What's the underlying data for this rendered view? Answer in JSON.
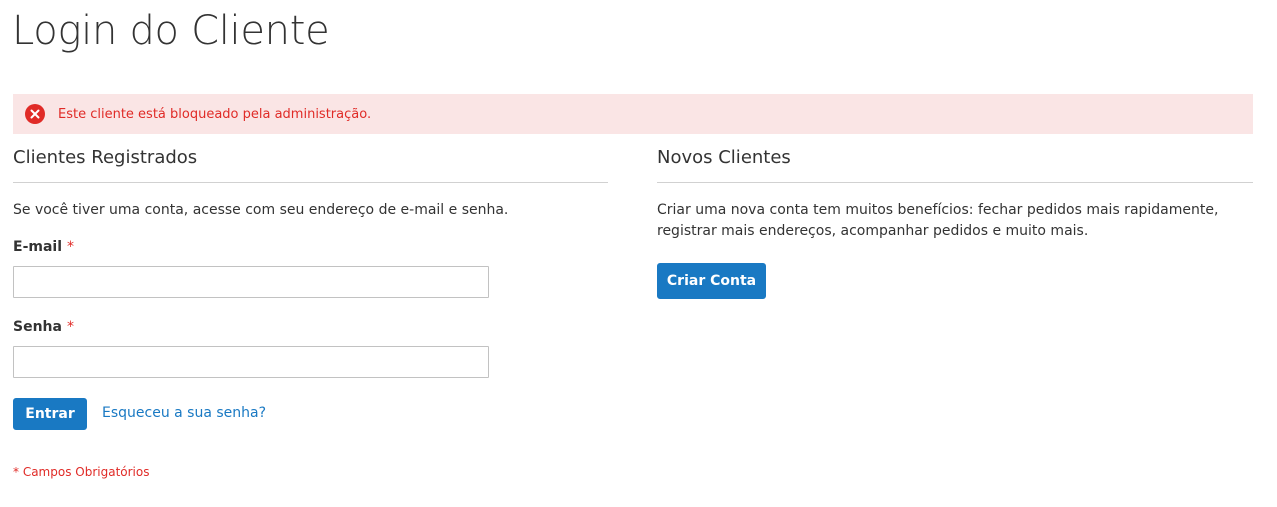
{
  "page": {
    "title": "Login do Cliente"
  },
  "error": {
    "message": "Este cliente está bloqueado pela administração.",
    "icon": "error-circle-x-icon",
    "color": "#e02b27",
    "background": "#fae5e5"
  },
  "registered": {
    "title": "Clientes Registrados",
    "intro": "Se você tiver uma conta, acesse com seu endereço de e-mail e senha.",
    "email_label": "E-mail",
    "email_value": "",
    "password_label": "Senha",
    "password_value": "",
    "required_star": "*",
    "submit_label": "Entrar",
    "forgot_link": "Esqueceu a sua senha?",
    "required_note": "* Campos Obrigatórios"
  },
  "new_customers": {
    "title": "Novos Clientes",
    "intro": "Criar uma nova conta tem muitos benefícios: fechar pedidos mais rapidamente, registrar mais endereços, acompanhar pedidos e muito mais.",
    "create_label": "Criar Conta"
  },
  "colors": {
    "accent": "#1979c3",
    "error": "#e02b27"
  }
}
